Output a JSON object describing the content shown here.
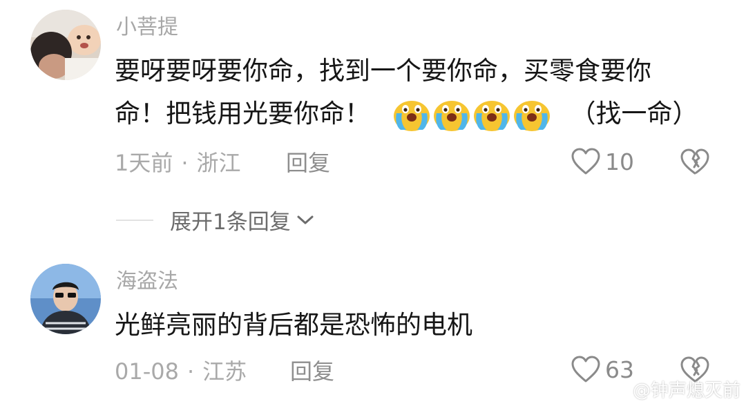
{
  "comments": [
    {
      "username": "小菩提",
      "text_line1": "要呀要呀要你命，找到一个要你命，买零食要你",
      "text_line2_before": "命！把钱用光要你命！",
      "text_line2_after": "（找一命）",
      "emoji": "crying-emoji",
      "emoji_count": 4,
      "time": "1天前",
      "location": "浙江",
      "reply_label": "回复",
      "like_count": "10"
    },
    {
      "username": "海盗法",
      "text_line1": "光鲜亮丽的背后都是恐怖的电机",
      "time": "01-08",
      "location": "江苏",
      "reply_label": "回复",
      "like_count": "63"
    }
  ],
  "expand_replies": {
    "label": "展开1条回复"
  },
  "watermark": {
    "text": "@钟声熄灭前"
  },
  "icons": {
    "like": "heart-outline-icon",
    "dislike": "broken-heart-icon",
    "expand": "chevron-down-icon",
    "watermark_logo": "weibo-logo"
  },
  "colors": {
    "text": "#161616",
    "meta": "#a9a9a9",
    "emoji_face": "#f6c531",
    "emoji_tear": "#4fb6ea"
  }
}
